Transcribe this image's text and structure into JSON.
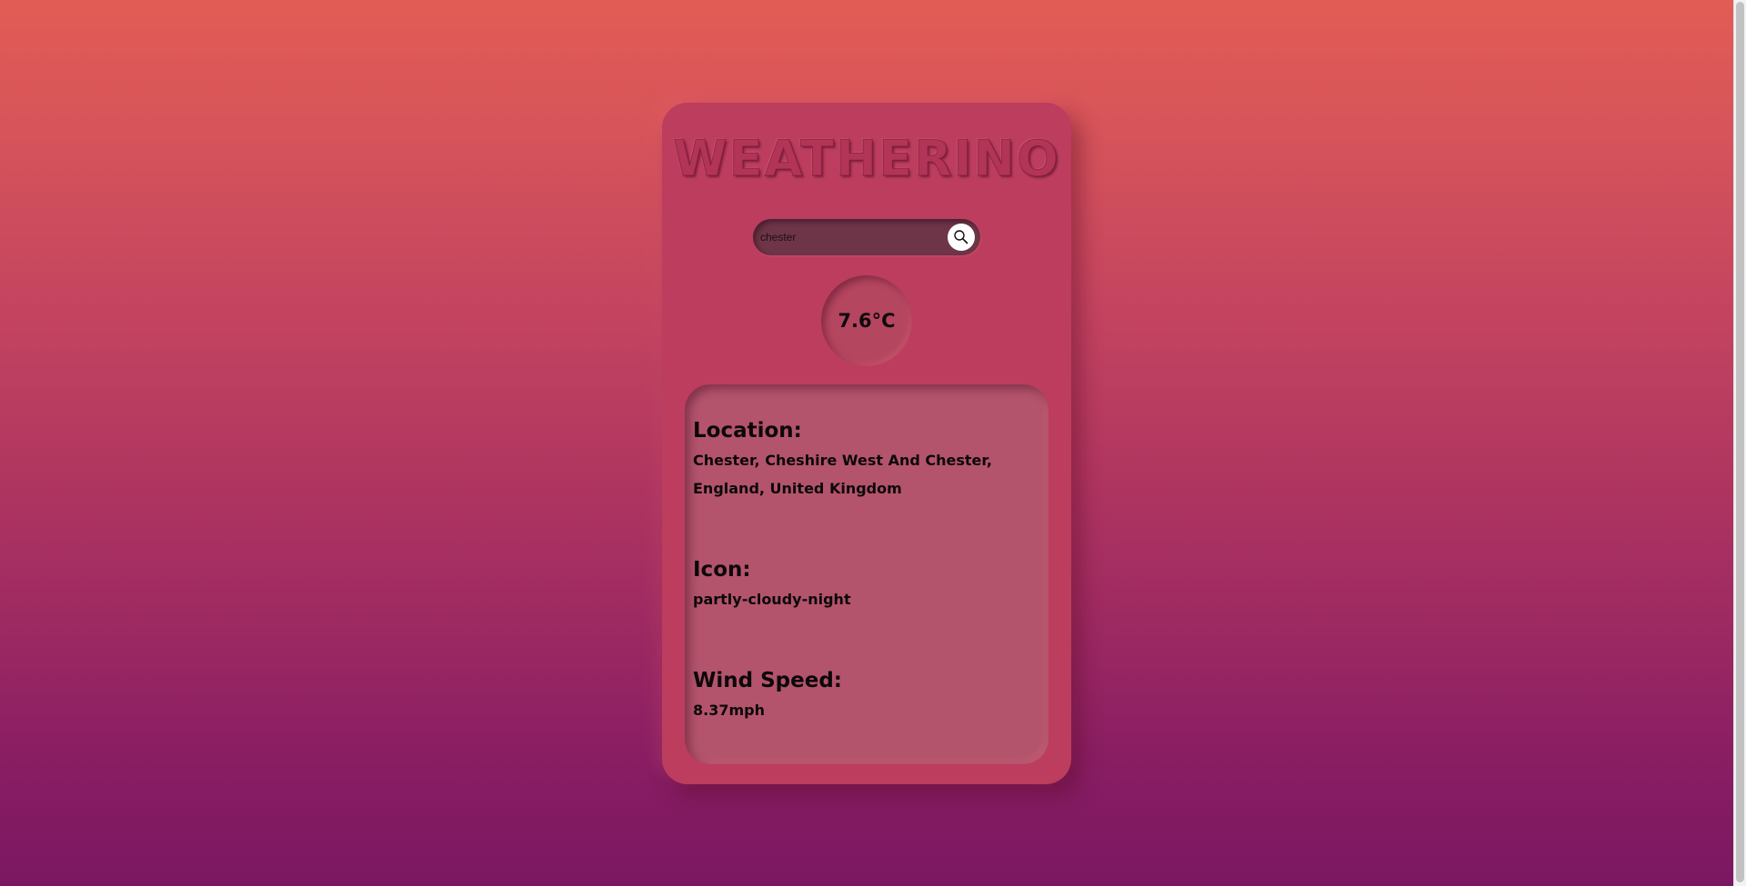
{
  "app": {
    "title": "WEATHERINO"
  },
  "search": {
    "value": "chester",
    "placeholder": ""
  },
  "weather": {
    "temperature": "7.6°C",
    "location_label": "Location:",
    "location_value": "Chester, Cheshire West And Chester, England, United Kingdom",
    "icon_label": "Icon:",
    "icon_value": "partly-cloudy-night",
    "wind_label": "Wind Speed:",
    "wind_value": "8.37mph"
  },
  "colors": {
    "gradient_top": "#e25c55",
    "gradient_bottom": "#7b1762",
    "card": "#bc3d5e",
    "search_field": "#6e3548",
    "panel": "#b3546c",
    "text": "#0c080a"
  },
  "icons": {
    "search_button": "search-icon"
  }
}
